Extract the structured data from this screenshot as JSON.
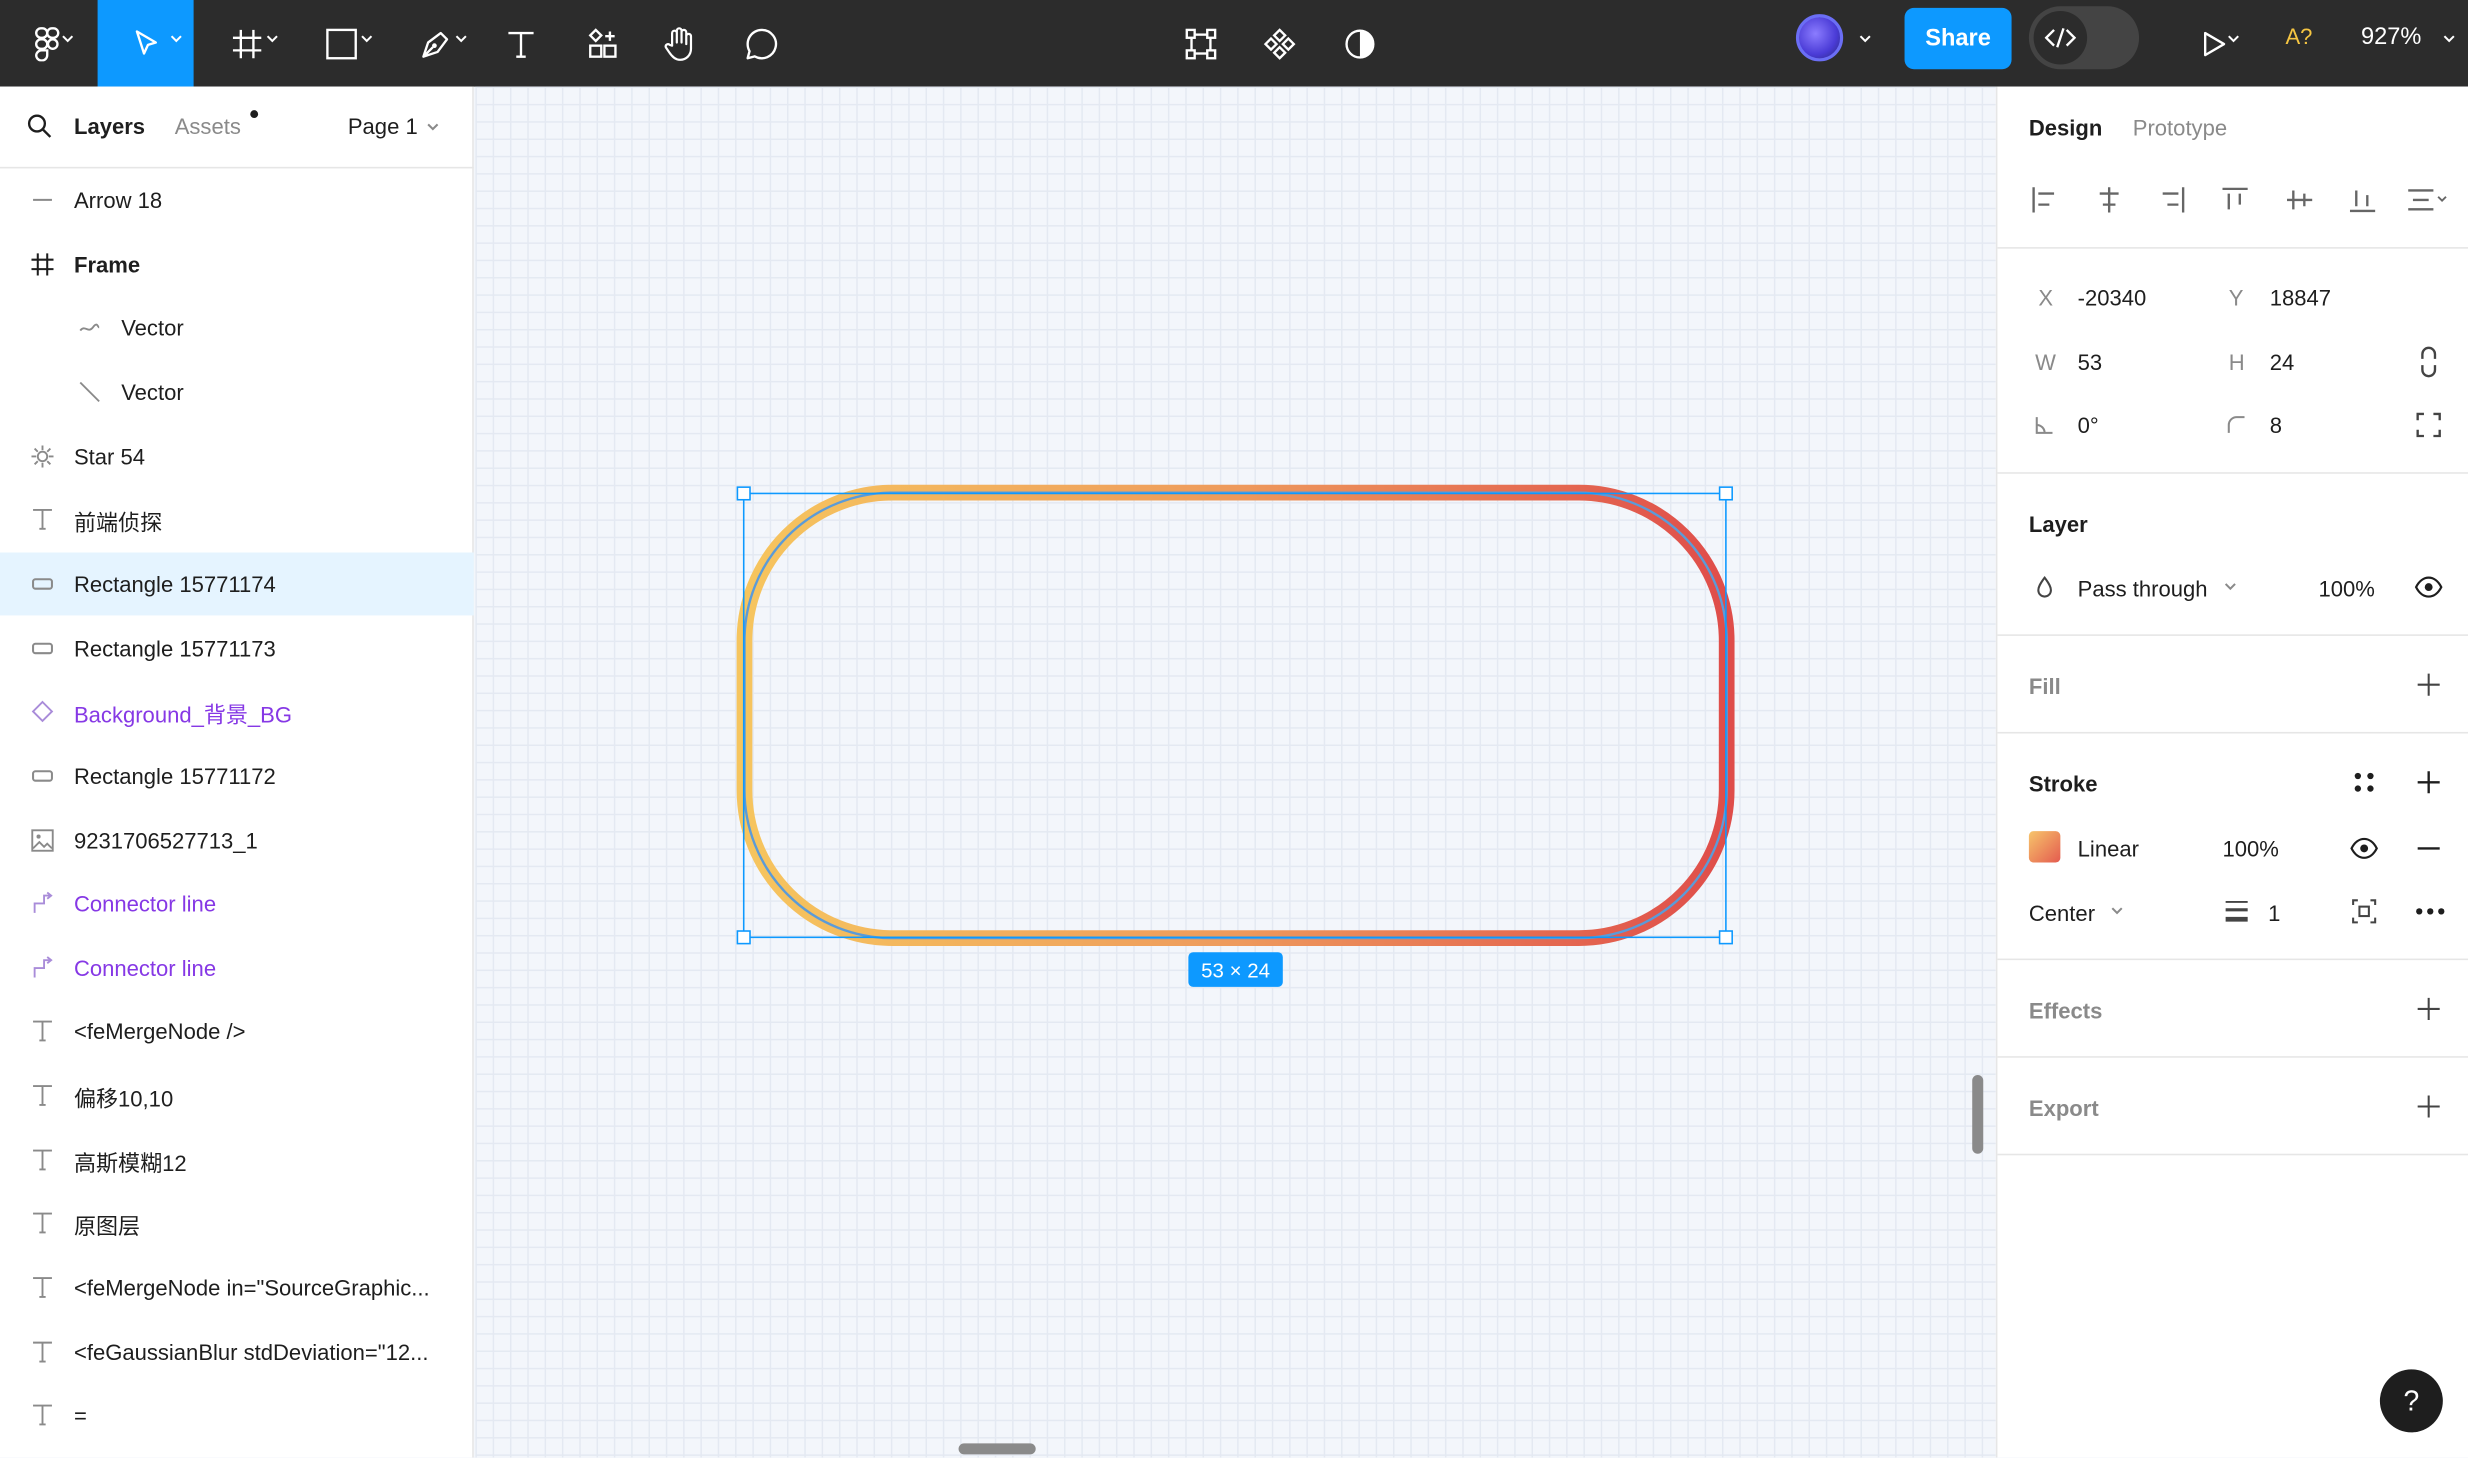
{
  "toolbar": {
    "share_label": "Share",
    "zoom_label": "927%",
    "a_label": "A?",
    "colors": {
      "bar": "#2c2c2c",
      "accent": "#0d99ff"
    }
  },
  "left_panel": {
    "tab_layers": "Layers",
    "tab_assets": "Assets",
    "page_label": "Page 1",
    "layers": [
      {
        "label": "Arrow 18",
        "icon": "line-icon"
      },
      {
        "label": "Frame",
        "icon": "frame-icon"
      },
      {
        "label": "Vector",
        "icon": "vector-curve-icon"
      },
      {
        "label": "Vector",
        "icon": "vector-line-icon"
      },
      {
        "label": "Star 54",
        "icon": "star-icon"
      },
      {
        "label": "前端侦探",
        "icon": "text-icon"
      },
      {
        "label": "Rectangle 15771174",
        "icon": "rectangle-icon"
      },
      {
        "label": "Rectangle 15771173",
        "icon": "rectangle-icon"
      },
      {
        "label": "Background_背景_BG",
        "icon": "component-icon"
      },
      {
        "label": "Rectangle 15771172",
        "icon": "rectangle-icon"
      },
      {
        "label": "9231706527713_1",
        "icon": "image-icon"
      },
      {
        "label": "Connector line",
        "icon": "connector-icon"
      },
      {
        "label": "Connector line",
        "icon": "connector-icon"
      },
      {
        "label": "<feMergeNode />",
        "icon": "text-icon"
      },
      {
        "label": "偏移10,10",
        "icon": "text-icon"
      },
      {
        "label": "高斯模糊12",
        "icon": "text-icon"
      },
      {
        "label": "原图层",
        "icon": "text-icon"
      },
      {
        "label": "<feMergeNode in=\"SourceGraphic...",
        "icon": "text-icon"
      },
      {
        "label": "<feGaussianBlur stdDeviation=\"12...",
        "icon": "text-icon"
      },
      {
        "label": "=",
        "icon": "text-icon"
      }
    ]
  },
  "canvas": {
    "dimension_badge": "53 × 24"
  },
  "right_panel": {
    "tab_design": "Design",
    "tab_prototype": "Prototype",
    "x_label": "X",
    "x_value": "-20340",
    "y_label": "Y",
    "y_value": "18847",
    "w_label": "W",
    "w_value": "53",
    "h_label": "H",
    "h_value": "24",
    "rotation_value": "0°",
    "radius_value": "8",
    "layer_title": "Layer",
    "blend_mode": "Pass through",
    "layer_opacity": "100%",
    "fill_title": "Fill",
    "stroke_title": "Stroke",
    "stroke_type": "Linear",
    "stroke_opacity": "100%",
    "stroke_position": "Center",
    "stroke_weight": "1",
    "effects_title": "Effects",
    "export_title": "Export"
  },
  "help_label": "?"
}
